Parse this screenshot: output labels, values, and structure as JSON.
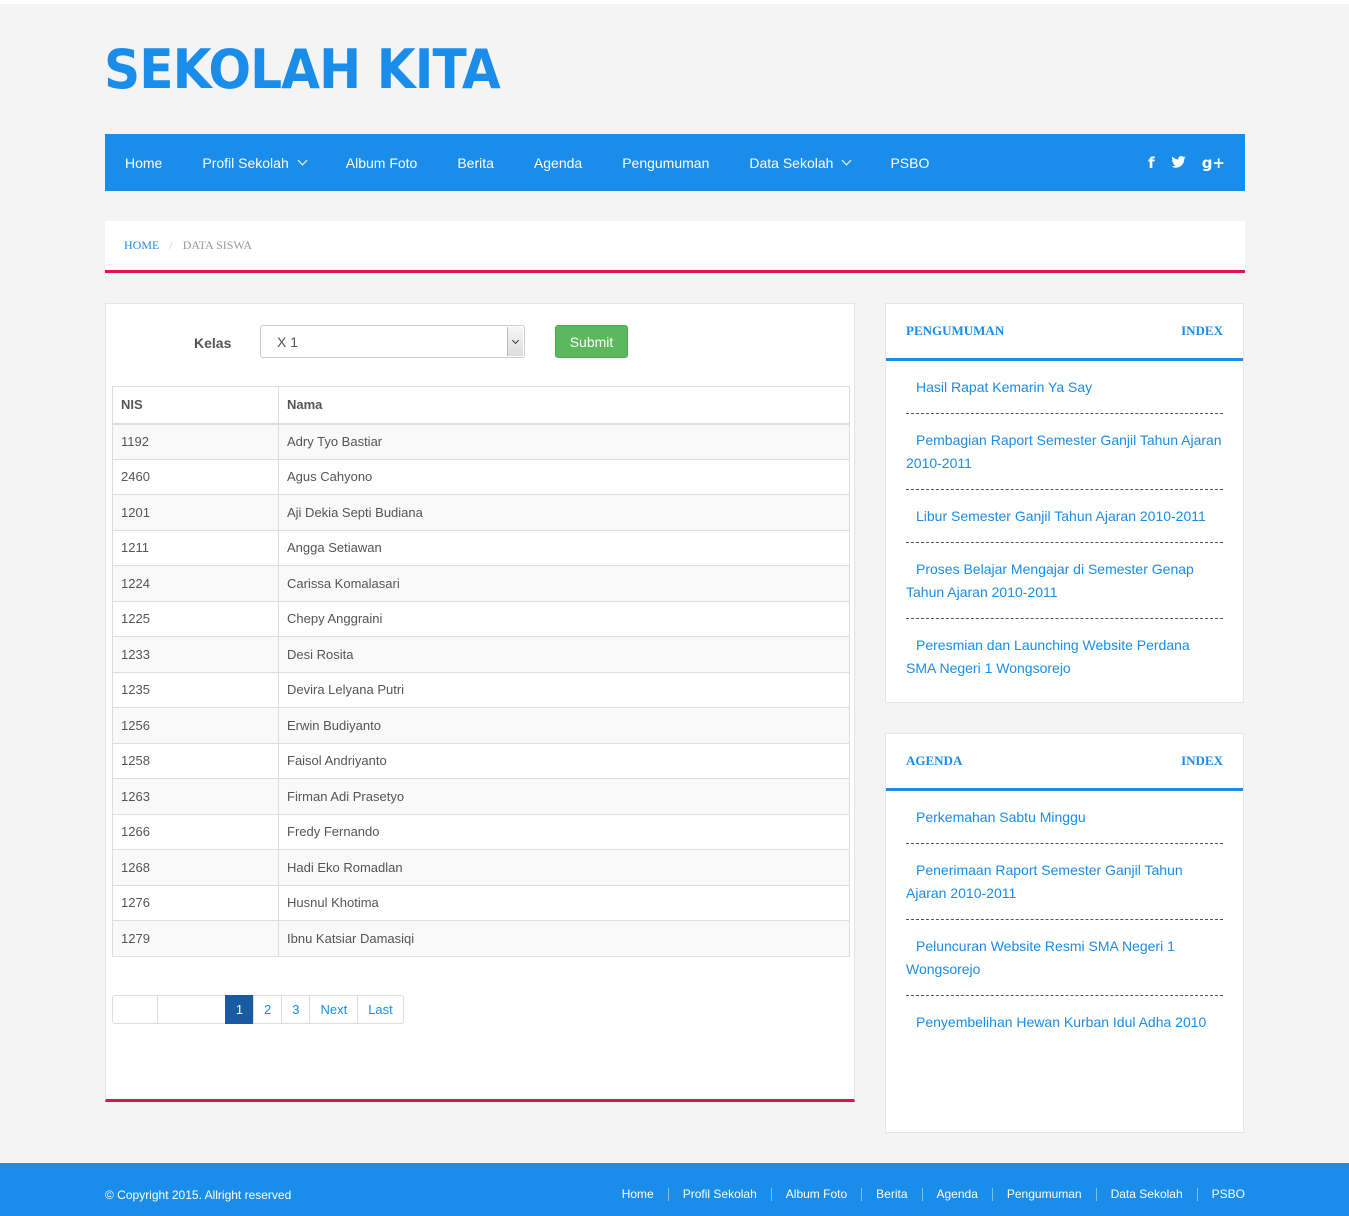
{
  "site": {
    "title": "SEKOLAH KITA"
  },
  "nav": {
    "items": [
      {
        "label": "Home",
        "dropdown": false
      },
      {
        "label": "Profil Sekolah",
        "dropdown": true
      },
      {
        "label": "Album Foto",
        "dropdown": false
      },
      {
        "label": "Berita",
        "dropdown": false
      },
      {
        "label": "Agenda",
        "dropdown": false
      },
      {
        "label": "Pengumuman",
        "dropdown": false
      },
      {
        "label": "Data Sekolah",
        "dropdown": true
      },
      {
        "label": "PSBO",
        "dropdown": false
      }
    ],
    "social": {
      "facebook": "f",
      "twitter": "🐦",
      "googleplus": "g+"
    }
  },
  "breadcrumb": {
    "home": "Home",
    "current": "Data Siswa"
  },
  "form": {
    "label": "Kelas",
    "selected": "X 1",
    "submit": "Submit"
  },
  "table": {
    "headers": [
      "NIS",
      "Nama"
    ],
    "rows": [
      [
        "1192",
        "Adry Tyo Bastiar"
      ],
      [
        "2460",
        "Agus Cahyono"
      ],
      [
        "1201",
        "Aji Dekia Septi Budiana"
      ],
      [
        "1211",
        "Angga Setiawan"
      ],
      [
        "1224",
        "Carissa Komalasari"
      ],
      [
        "1225",
        "Chepy Anggraini"
      ],
      [
        "1233",
        "Desi Rosita"
      ],
      [
        "1235",
        "Devira Lelyana Putri"
      ],
      [
        "1256",
        "Erwin Budiyanto"
      ],
      [
        "1258",
        "Faisol Andriyanto"
      ],
      [
        "1263",
        "Firman Adi Prasetyo"
      ],
      [
        "1266",
        "Fredy Fernando"
      ],
      [
        "1268",
        "Hadi Eko Romadlan"
      ],
      [
        "1276",
        "Husnul Khotima"
      ],
      [
        "1279",
        "Ibnu Katsiar Damasiqi"
      ]
    ]
  },
  "pagination": {
    "pages": [
      "1",
      "2",
      "3"
    ],
    "active": "1",
    "next": "Next",
    "last": "Last"
  },
  "pengumuman": {
    "title": "Pengumuman",
    "index": "Index",
    "items": [
      "Hasil Rapat Kemarin Ya Say",
      "Pembagian Raport Semester Ganjil Tahun Ajaran 2010-2011",
      "Libur Semester Ganjil Tahun Ajaran 2010-2011",
      "Proses Belajar Mengajar di Semester Genap Tahun Ajaran 2010-2011",
      "Peresmian dan Launching Website Perdana SMA Negeri 1 Wongsorejo"
    ]
  },
  "agenda": {
    "title": "Agenda",
    "index": "Index",
    "items": [
      "Perkemahan Sabtu Minggu",
      "Penerimaan Raport Semester Ganjil Tahun Ajaran 2010-2011",
      "Peluncuran Website Resmi SMA Negeri 1 Wongsorejo",
      "Penyembelihan Hewan Kurban Idul Adha 2010"
    ]
  },
  "footer": {
    "copyright": "© Copyright 2015. Allright reserved",
    "links": [
      "Home",
      "Profil Sekolah",
      "Album Foto",
      "Berita",
      "Agenda",
      "Pengumuman",
      "Data Sekolah",
      "PSBO"
    ]
  }
}
